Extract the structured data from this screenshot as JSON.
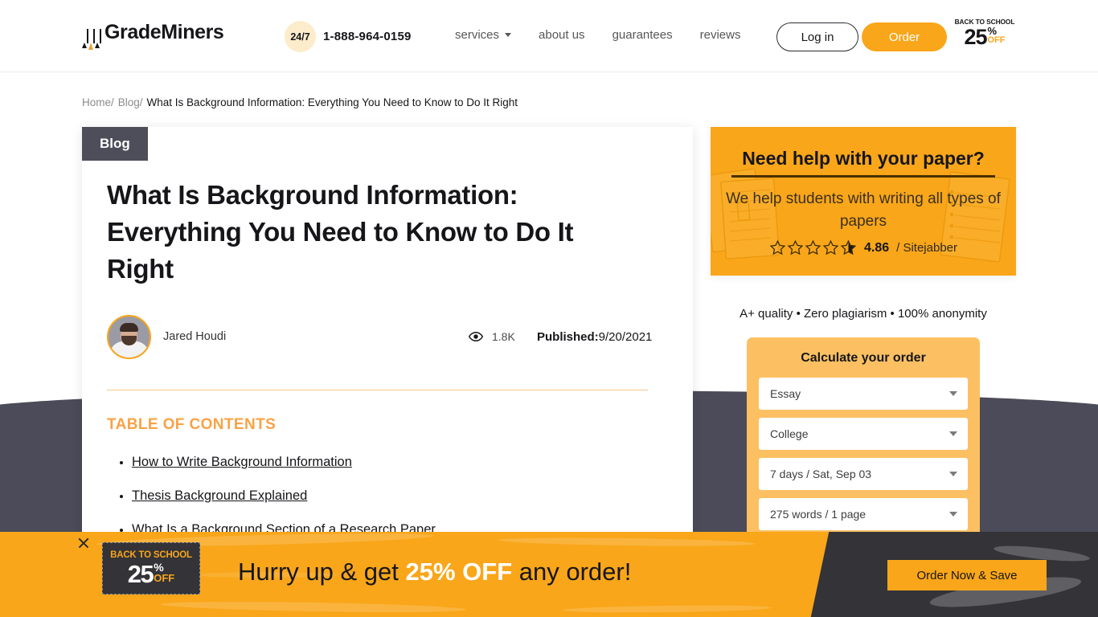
{
  "header": {
    "logo_text": "GradeMiners",
    "logo_icon": "pencils-icon",
    "support_badge": "24/7",
    "phone": "1-888-964-0159",
    "nav": [
      {
        "label": "services",
        "has_dropdown": true
      },
      {
        "label": "about us",
        "has_dropdown": false
      },
      {
        "label": "guarantees",
        "has_dropdown": false
      },
      {
        "label": "reviews",
        "has_dropdown": false
      }
    ],
    "login_label": "Log in",
    "order_label": "Order",
    "promo_badge": {
      "top": "BACK TO SCHOOL",
      "number": "25",
      "percent": "%",
      "off": "OFF"
    }
  },
  "breadcrumb": {
    "home": "Home/",
    "blog": "Blog/",
    "current": "What Is Background Information: Everything You Need to Know to Do It Right"
  },
  "article": {
    "tag": "Blog",
    "title": "What Is Background Information: Everything You Need to Know to Do It Right",
    "author": "Jared Houdi",
    "views": "1.8K",
    "views_icon": "eye-icon",
    "published_label": "Published:",
    "published_date": "9/20/2021",
    "toc_title": "TABLE OF CONTENTS",
    "toc": [
      "How to Write Background Information",
      "Thesis Background Explained",
      "What Is a Background Section of a Research Paper"
    ]
  },
  "sidebar": {
    "promo_heading": "Need help with your paper?",
    "promo_sub": "We help students with writing all types of papers",
    "rating_score": "4.86",
    "rating_source": "/ Sitejabber",
    "rating_stars": 4.86,
    "quality_line": "A+ quality • Zero plagiarism • 100% anonymity",
    "calculator": {
      "title": "Calculate your order",
      "fields": [
        {
          "name": "paper-type",
          "value": "Essay"
        },
        {
          "name": "academic-level",
          "value": "College"
        },
        {
          "name": "deadline",
          "value": "7 days / Sat, Sep 03"
        },
        {
          "name": "pages",
          "value": "275 words / 1 page"
        }
      ]
    }
  },
  "bottom_banner": {
    "badge": {
      "top": "BACK TO SCHOOL",
      "number": "25",
      "percent": "%",
      "off": "OFF"
    },
    "text_before": "Hurry up & get ",
    "text_highlight": "25% OFF",
    "text_after": " any order!",
    "cta_label": "Order Now & Save",
    "close_icon": "close-icon"
  },
  "colors": {
    "accent": "#f9a61a",
    "accent_light": "#fcc062",
    "dark": "#4b4b59",
    "banner_dark": "#333338",
    "text": "#16161a"
  }
}
